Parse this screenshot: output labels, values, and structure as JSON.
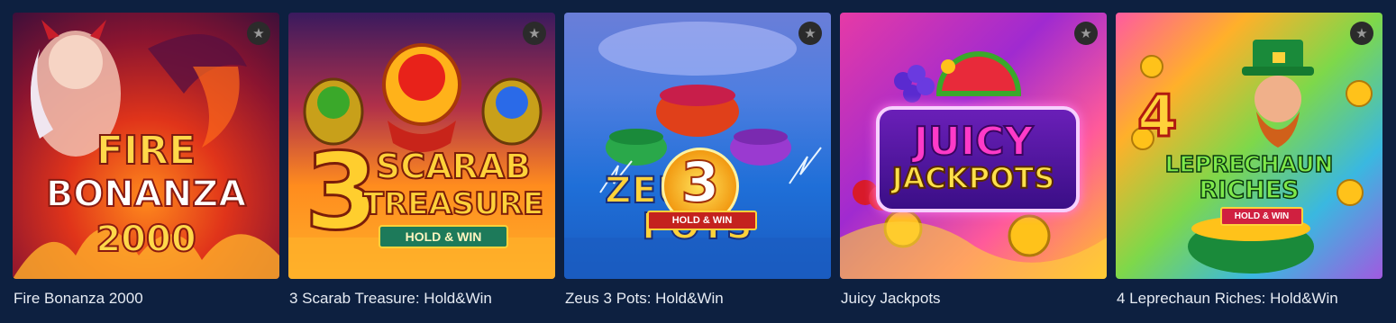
{
  "games": [
    {
      "title": "Fire Bonanza 2000",
      "logo_lines": [
        "FIRE",
        "BONANZA",
        "2000"
      ],
      "colors": {
        "primary": "#e0341a",
        "accent": "#ffd84a"
      }
    },
    {
      "title": "3 Scarab Treasure: Hold&Win",
      "logo_big": "3",
      "logo_lines": [
        "SCARAB",
        "TREASURE"
      ],
      "badge": "HOLD & WIN",
      "colors": {
        "primary": "#ff8c1e",
        "accent": "#ffd23a"
      }
    },
    {
      "title": "Zeus 3 Pots: Hold&Win",
      "logo_big": "3",
      "logo_lines": [
        "ZEUS",
        "POTS"
      ],
      "badge": "HOLD & WIN",
      "colors": {
        "primary": "#1f6fd8",
        "accent": "#ffd23a"
      }
    },
    {
      "title": "Juicy Jackpots",
      "logo_lines": [
        "JUICY",
        "JACKPOTS"
      ],
      "colors": {
        "primary": "#a02ad0",
        "accent": "#ff3ac8"
      }
    },
    {
      "title": "4 Leprechaun Riches: Hold&Win",
      "logo_big": "4",
      "logo_lines": [
        "LEPRECHAUN",
        "RICHES"
      ],
      "badge": "HOLD & WIN",
      "colors": {
        "primary": "#7ed84a",
        "accent": "#ffd23a"
      }
    }
  ],
  "favorite_icon": "star-icon",
  "page_background": "#0d2040"
}
